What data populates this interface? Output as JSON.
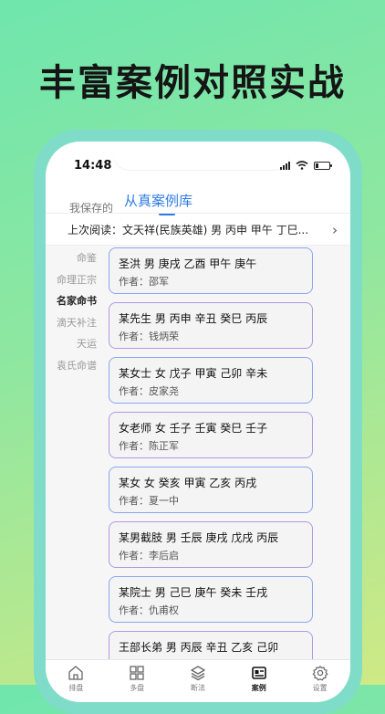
{
  "promo": {
    "headline": "丰富案例对照实战"
  },
  "status_bar": {
    "time": "14:48"
  },
  "tabs": [
    {
      "label": "我保存的",
      "active": false
    },
    {
      "label": "从真案例库",
      "active": true
    }
  ],
  "last_read": {
    "text": "上次阅读：文天祥(民族英雄) 男 丙申 甲午 丁巳...",
    "chevron_icon": "chevron-right-icon"
  },
  "sidebar": {
    "items": [
      {
        "label": "命鉴"
      },
      {
        "label": "命理正宗"
      },
      {
        "label": "名家命书"
      },
      {
        "label": "滴天补注"
      },
      {
        "label": "天运"
      },
      {
        "label": "袁氏命谱"
      }
    ],
    "active_index": 2
  },
  "cases": [
    {
      "title": "圣洪 男 庚戌 乙酉 甲午 庚午",
      "author": "作者：邵军"
    },
    {
      "title": "某先生 男 丙申 辛丑 癸巳 丙辰",
      "author": "作者：钱炳荣"
    },
    {
      "title": "某女士 女 戊子 甲寅 己卯 辛未",
      "author": "作者：皮家尧"
    },
    {
      "title": "女老师 女 壬子 壬寅 癸巳 壬子",
      "author": "作者：陈正军"
    },
    {
      "title": "某女 女 癸亥 甲寅 乙亥 丙戌",
      "author": "作者：夏一中"
    },
    {
      "title": "某男截肢 男 壬辰 庚戌 戊戌 丙辰",
      "author": "作者：李后启"
    },
    {
      "title": "某院士 男 己巳 庚午 癸未 壬戌",
      "author": "作者：仇甫权"
    },
    {
      "title": "王部长弟 男 丙辰 辛丑 乙亥 己卯",
      "author": ""
    }
  ],
  "bottom_nav": [
    {
      "label": "排盘",
      "icon": "home-icon"
    },
    {
      "label": "多盘",
      "icon": "grid-icon"
    },
    {
      "label": "断法",
      "icon": "layers-icon"
    },
    {
      "label": "案例",
      "icon": "case-icon",
      "active": true
    },
    {
      "label": "设置",
      "icon": "gear-icon"
    }
  ],
  "colors": {
    "accent": "#2f7be5",
    "card_border_blue": "#8ba6f0",
    "card_border_purple": "#ad9ae2"
  }
}
